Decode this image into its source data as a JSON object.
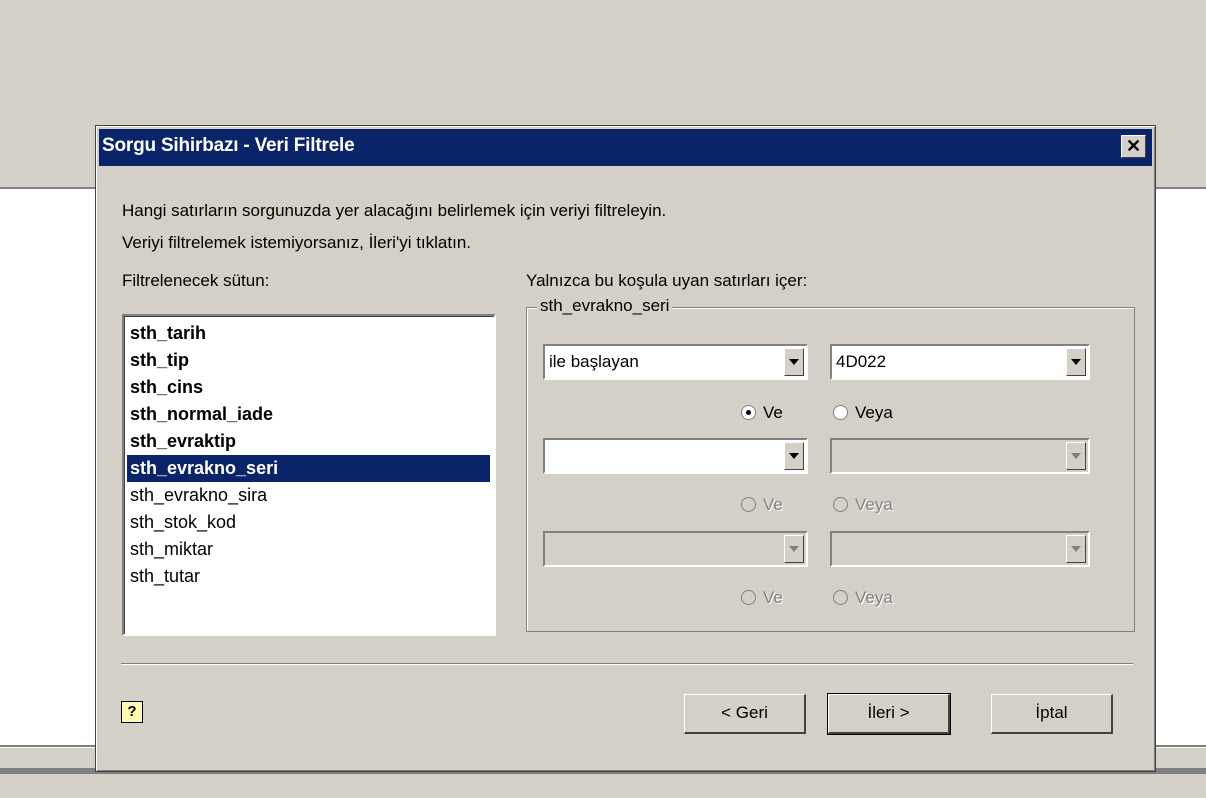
{
  "dialog": {
    "title": "Sorgu Sihirbazı - Veri Filtrele",
    "close_glyph": "✕",
    "instruction_line1": "Hangi satırların sorgunuzda yer alacağını belirlemek için veriyi filtreleyin.",
    "instruction_line2": "Veriyi filtrelemek istemiyorsanız, İleri'yi tıklatın.",
    "column_list_label": "Filtrelenecek sütun:",
    "condition_label": "Yalnızca bu koşula uyan satırları içer:"
  },
  "columns": [
    {
      "name": "sth_tarih",
      "bold": true
    },
    {
      "name": "sth_tip",
      "bold": true
    },
    {
      "name": "sth_cins",
      "bold": true
    },
    {
      "name": "sth_normal_iade",
      "bold": true
    },
    {
      "name": "sth_evraktip",
      "bold": true
    },
    {
      "name": "sth_evrakno_seri",
      "bold": true,
      "selected": true
    },
    {
      "name": "sth_evrakno_sira",
      "bold": false
    },
    {
      "name": "sth_stok_kod",
      "bold": false
    },
    {
      "name": "sth_miktar",
      "bold": false
    },
    {
      "name": "sth_tutar",
      "bold": false
    }
  ],
  "group": {
    "label": "sth_evrakno_seri",
    "rows": [
      {
        "operator": "ile başlayan",
        "value": "4D022",
        "enabled": true
      },
      {
        "operator": "",
        "value": "",
        "enabled": false
      },
      {
        "operator": "",
        "value": "",
        "enabled": false
      }
    ],
    "radios": [
      {
        "and_label": "Ve",
        "or_label": "Veya",
        "selected": "and",
        "enabled": true
      },
      {
        "and_label": "Ve",
        "or_label": "Veya",
        "selected": null,
        "enabled": false
      },
      {
        "and_label": "Ve",
        "or_label": "Veya",
        "selected": null,
        "enabled": false
      }
    ]
  },
  "buttons": {
    "help": "?",
    "back": "< Geri",
    "next": "İleri >",
    "cancel": "İptal"
  }
}
